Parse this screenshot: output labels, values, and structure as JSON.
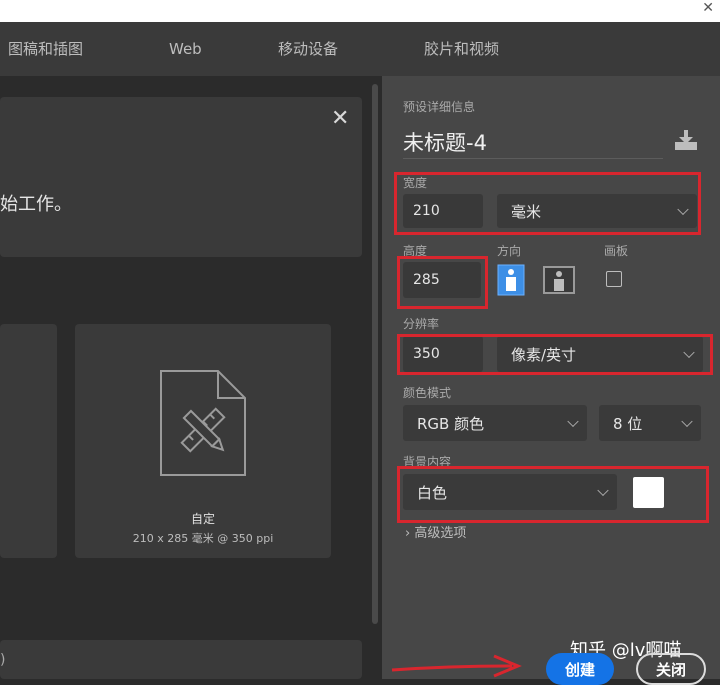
{
  "tabs": [
    "图稿和插图",
    "Web",
    "移动设备",
    "胶片和视频"
  ],
  "left": {
    "message_fragment": "始工作。",
    "custom_card": {
      "title": "自定",
      "subtitle": "210 x 285 毫米 @ 350 ppi"
    },
    "bottom_fragment": ")"
  },
  "preset": {
    "section_label": "预设详细信息",
    "doc_name": "未标题-4",
    "width_label": "宽度",
    "width_value": "210",
    "width_unit": "毫米",
    "height_label": "高度",
    "height_value": "285",
    "orientation_label": "方向",
    "artboard_label": "画板",
    "resolution_label": "分辨率",
    "resolution_value": "350",
    "resolution_unit": "像素/英寸",
    "color_mode_label": "颜色模式",
    "color_mode_value": "RGB 颜色",
    "bit_depth_value": "8 位",
    "background_label": "背景内容",
    "background_value": "白色",
    "background_swatch": "#ffffff",
    "advanced_label": "高级选项"
  },
  "buttons": {
    "create": "创建",
    "close": "关闭"
  },
  "watermark": "知乎 @lv啊喵",
  "colors": {
    "accent": "#1473e6",
    "highlight": "#d8262e",
    "active_orientation": "#3d8fe6"
  }
}
